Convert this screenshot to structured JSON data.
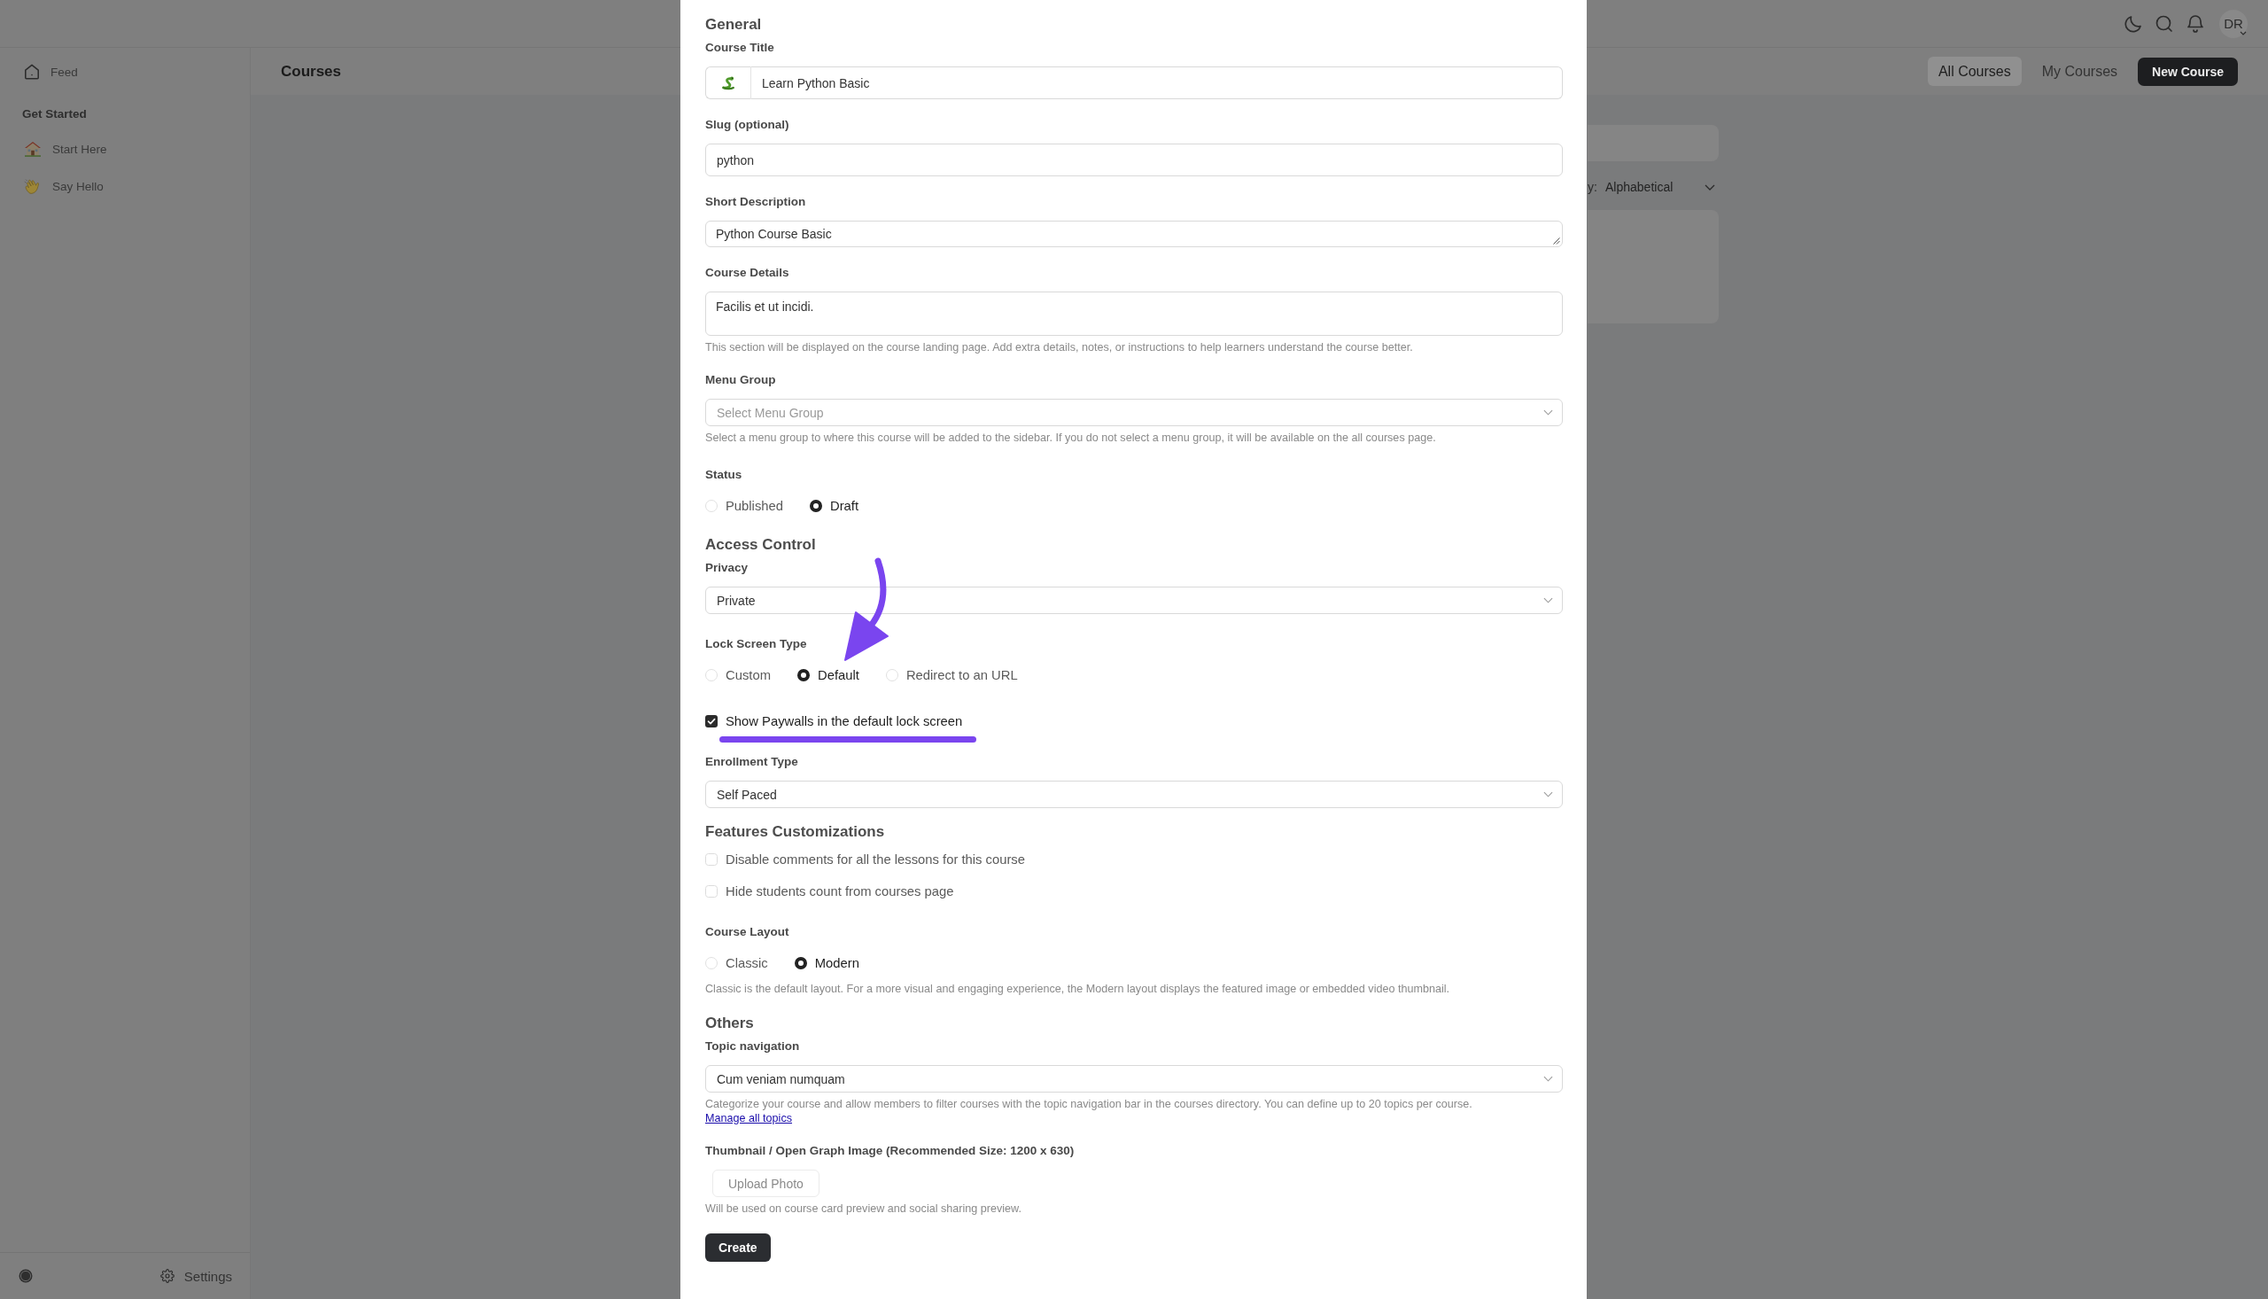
{
  "topbar": {
    "avatar": "DR"
  },
  "sidebar": {
    "links": [
      {
        "label": "Feed",
        "selected": false
      }
    ],
    "groups": [
      {
        "title": "Get Started",
        "items": [
          {
            "label": "Start Here",
            "selected": false
          },
          {
            "label": "Say Hello",
            "selected": false
          }
        ]
      }
    ],
    "footer": {
      "settings": "Settings"
    }
  },
  "header": {
    "title": "Courses",
    "tabs": [
      {
        "label": "All Courses",
        "selected": true
      },
      {
        "label": "My Courses",
        "selected": false
      }
    ],
    "new_button": "New Course"
  },
  "filter_panel": {
    "sort": {
      "label": "y:",
      "value": "Alphabetical"
    }
  },
  "form": {
    "fields": [
      {
        "kind": "heading",
        "text": "General"
      },
      {
        "kind": "icon_input",
        "label": "Course Title",
        "value": "Learn Python Basic"
      },
      {
        "kind": "input",
        "label": "Slug (optional)",
        "value": "python"
      },
      {
        "kind": "textarea",
        "label": "Short Description",
        "value": "Python Course Basic"
      },
      {
        "kind": "editor",
        "label": "Course Details",
        "value": "Facilis et ut incidi.",
        "help": "This section will be displayed on the course landing page. Add extra details, notes, or instructions to help learners understand the course better."
      },
      {
        "kind": "select",
        "label": "Menu Group",
        "placeholder": "Select Menu Group",
        "help": "Select a menu group to where this course will be added to the sidebar. If you do not select a menu group, it will be available on the all courses page."
      },
      {
        "kind": "radio",
        "label": "Status",
        "options": [
          {
            "label": "Published",
            "selected": false
          },
          {
            "label": "Draft",
            "selected": true
          }
        ]
      },
      {
        "kind": "heading",
        "text": "Access Control"
      },
      {
        "kind": "select",
        "label": "Privacy",
        "value": "Private"
      },
      {
        "kind": "radio",
        "label": "Lock Screen Type",
        "options": [
          {
            "label": "Custom",
            "selected": false,
            "arrow": false
          },
          {
            "label": "Default",
            "selected": true,
            "arrow": true
          },
          {
            "label": "Redirect to an URL",
            "selected": false,
            "arrow": false
          }
        ]
      },
      {
        "kind": "checkbox",
        "label": "Show Paywalls in the default lock screen",
        "checked": true,
        "underlined": true
      },
      {
        "kind": "select",
        "label": "Enrollment Type",
        "value": "Self Paced"
      },
      {
        "kind": "heading",
        "text": "Features Customizations"
      },
      {
        "kind": "checkbox",
        "label": "Disable comments for all the lessons for this course",
        "checked": false,
        "underlined": false
      },
      {
        "kind": "checkbox",
        "label": "Hide students count from courses page",
        "checked": false,
        "underlined": false
      },
      {
        "kind": "radio",
        "label": "Course Layout",
        "options": [
          {
            "label": "Classic",
            "selected": false
          },
          {
            "label": "Modern",
            "selected": true
          }
        ],
        "help": "Classic is the default layout. For a more visual and engaging experience, the Modern layout displays the featured image or embedded video thumbnail."
      },
      {
        "kind": "heading",
        "text": "Others"
      },
      {
        "kind": "select",
        "label": "Topic navigation",
        "value": "Cum veniam numquam",
        "help": "Categorize your course and allow members to filter courses with the topic navigation bar in the courses directory. You can define up to 20 topics per course.",
        "link": "Manage all topics"
      },
      {
        "kind": "upload",
        "label": "Thumbnail / Open Graph Image (Recommended Size: 1200 x 630)",
        "button": "Upload Photo",
        "help": "Will be used on course card preview and social sharing preview."
      },
      {
        "kind": "submit",
        "button": "Create"
      }
    ]
  }
}
